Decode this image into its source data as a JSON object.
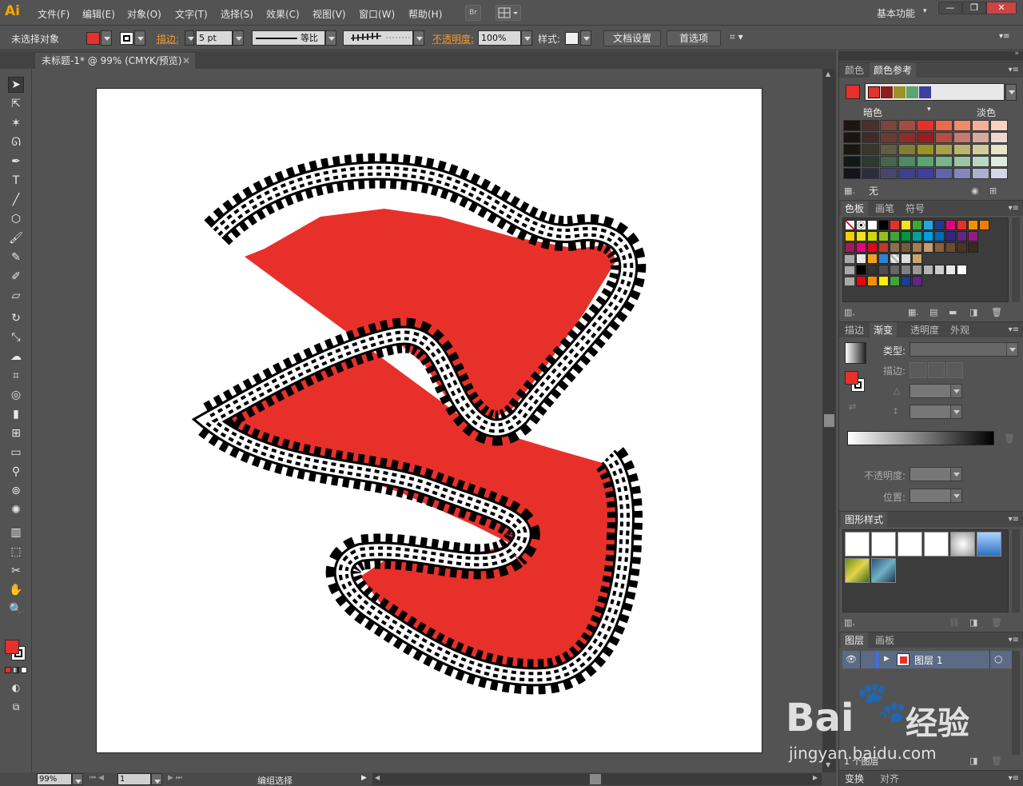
{
  "app": {
    "logo": "Ai",
    "workspace": "基本功能"
  },
  "menu": [
    "文件(F)",
    "编辑(E)",
    "对象(O)",
    "文字(T)",
    "选择(S)",
    "效果(C)",
    "视图(V)",
    "窗口(W)",
    "帮助(H)"
  ],
  "menu_br": "Br",
  "window_buttons": {
    "minimize": "—",
    "restore": "❐",
    "close": "✕"
  },
  "control": {
    "selection": "未选择对象",
    "stroke_label": "描边:",
    "stroke_value": "5 pt",
    "profile": "等比",
    "opacity_label": "不透明度:",
    "opacity_value": "100%",
    "style_label": "样式:",
    "doc_setup": "文档设置",
    "prefs": "首选项"
  },
  "document_tab": {
    "title": "未标题-1* @ 99% (CMYK/预览)",
    "close": "✕"
  },
  "colors": {
    "fill": "#e8302a",
    "accent_orange": "#f39c30",
    "artwork_red": "#e8302a"
  },
  "tools": [
    "selection-tool",
    "direct-selection-tool",
    "magic-wand-tool",
    "lasso-tool",
    "pen-tool",
    "type-tool",
    "line-tool",
    "polygon-tool",
    "paintbrush-tool",
    "pencil-tool",
    "blob-brush-tool",
    "eraser-tool",
    "rotate-tool",
    "scale-tool",
    "warp-tool",
    "free-transform-tool",
    "shape-builder-tool",
    "graph-tool",
    "mesh-tool",
    "gradient-tool",
    "eyedropper-tool",
    "blend-tool",
    "symbol-sprayer-tool",
    "column-graph-tool",
    "artboard-tool",
    "slice-tool",
    "hand-tool",
    "zoom-tool"
  ],
  "status": {
    "zoom": "99%",
    "artboard": "1",
    "mode": "编组选择"
  },
  "panels": {
    "color_tabs": {
      "color": "颜色",
      "guide": "颜色参考"
    },
    "guide_labels": {
      "dark": "暗色",
      "light": "淡色"
    },
    "guide_none": "无",
    "swatch_tabs": {
      "swatches": "色板",
      "brushes": "画笔",
      "symbols": "符号"
    },
    "gradient_tabs": {
      "stroke": "描边",
      "gradient": "渐变",
      "transparency": "透明度",
      "appearance": "外观"
    },
    "gradient_labels": {
      "type": "类型:",
      "stroke": "描边:",
      "opacity": "不透明度:",
      "position": "位置:"
    },
    "graphic_styles": "图形样式",
    "layers_tabs": {
      "layers": "图层",
      "artboards": "画板"
    },
    "layer_name": "图层 1",
    "layer_count": "1 个图层",
    "bottom_tabs": {
      "transform": "变换",
      "align": "对齐"
    }
  },
  "watermark": {
    "brand": "Bai",
    "brand2": "du",
    "tail": "经验",
    "url": "jingyan.baidu.com"
  }
}
